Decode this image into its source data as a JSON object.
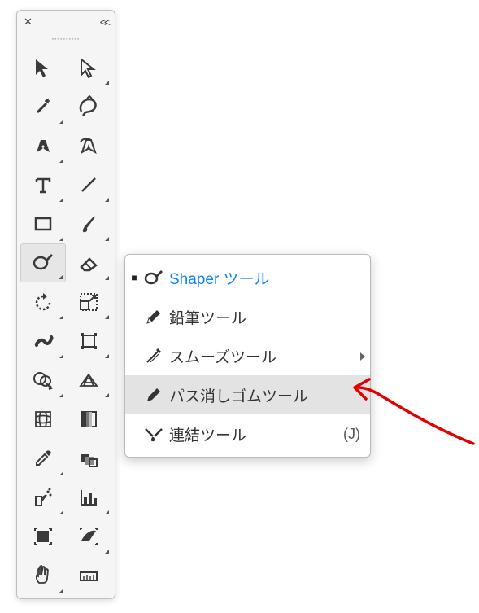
{
  "toolbar": {
    "tools": [
      {
        "name": "selection-tool",
        "has_flyout": false
      },
      {
        "name": "direct-selection-tool",
        "has_flyout": true
      },
      {
        "name": "magic-wand-tool",
        "has_flyout": true
      },
      {
        "name": "lasso-tool",
        "has_flyout": false
      },
      {
        "name": "pen-tool",
        "has_flyout": true
      },
      {
        "name": "curvature-tool",
        "has_flyout": false
      },
      {
        "name": "type-tool",
        "has_flyout": true
      },
      {
        "name": "line-segment-tool",
        "has_flyout": true
      },
      {
        "name": "rectangle-tool",
        "has_flyout": true
      },
      {
        "name": "paintbrush-tool",
        "has_flyout": true
      },
      {
        "name": "shaper-tool",
        "has_flyout": true
      },
      {
        "name": "eraser-tool",
        "has_flyout": true
      },
      {
        "name": "rotate-tool",
        "has_flyout": true
      },
      {
        "name": "scale-tool",
        "has_flyout": true
      },
      {
        "name": "width-tool",
        "has_flyout": true
      },
      {
        "name": "free-transform-tool",
        "has_flyout": true
      },
      {
        "name": "shape-builder-tool",
        "has_flyout": true
      },
      {
        "name": "perspective-grid-tool",
        "has_flyout": true
      },
      {
        "name": "mesh-tool",
        "has_flyout": false
      },
      {
        "name": "gradient-tool",
        "has_flyout": false
      },
      {
        "name": "eyedropper-tool",
        "has_flyout": true
      },
      {
        "name": "blend-tool",
        "has_flyout": false
      },
      {
        "name": "symbol-sprayer-tool",
        "has_flyout": true
      },
      {
        "name": "column-graph-tool",
        "has_flyout": true
      },
      {
        "name": "artboard-tool",
        "has_flyout": false
      },
      {
        "name": "slice-tool",
        "has_flyout": true
      },
      {
        "name": "hand-tool",
        "has_flyout": true
      },
      {
        "name": "ruler-tool",
        "has_flyout": false
      }
    ],
    "selected_index": 10
  },
  "flyout": {
    "items": [
      {
        "name": "shaper-tool",
        "label": "Shaper ツール",
        "shortcut": "",
        "active": true,
        "hover": false,
        "has_submenu": false
      },
      {
        "name": "pencil-tool",
        "label": "鉛筆ツール",
        "shortcut": "",
        "active": false,
        "hover": false,
        "has_submenu": false
      },
      {
        "name": "smooth-tool",
        "label": "スムーズツール",
        "shortcut": "",
        "active": false,
        "hover": false,
        "has_submenu": true
      },
      {
        "name": "path-eraser-tool",
        "label": "パス消しゴムツール",
        "shortcut": "",
        "active": false,
        "hover": true,
        "has_submenu": false
      },
      {
        "name": "join-tool",
        "label": "連結ツール",
        "shortcut": "(J)",
        "active": false,
        "hover": false,
        "has_submenu": false
      }
    ]
  },
  "annotation": {
    "color": "#e30000"
  }
}
